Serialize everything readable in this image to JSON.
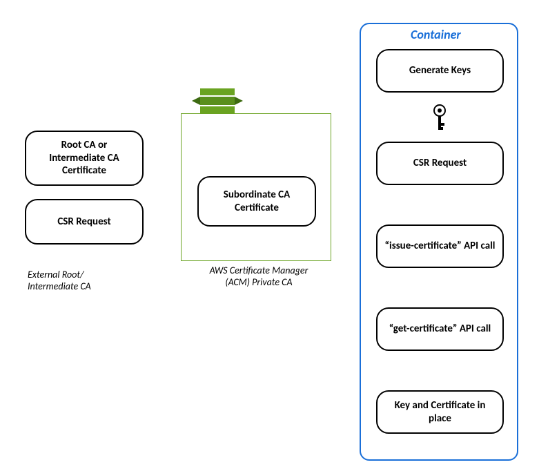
{
  "external_ca": {
    "caption": "External Root/\nIntermediate CA",
    "root_cert": "Root CA or Intermediate CA Certificate",
    "csr_request": "CSR Request"
  },
  "private_ca": {
    "caption": "AWS Certificate Manager\n(ACM) Private CA",
    "sub_ca_cert": "Subordinate CA Certificate"
  },
  "container": {
    "title": "Container",
    "steps": {
      "generate_keys": "Generate Keys",
      "csr_request": "CSR Request",
      "issue_cert": "“issue-certificate” API call",
      "get_cert": "“get-certificate” API call",
      "key_cert_in_place": "Key and Certificate in place"
    }
  },
  "icons": {
    "aws_service": "aws-service-icon",
    "key": "key-icon"
  }
}
